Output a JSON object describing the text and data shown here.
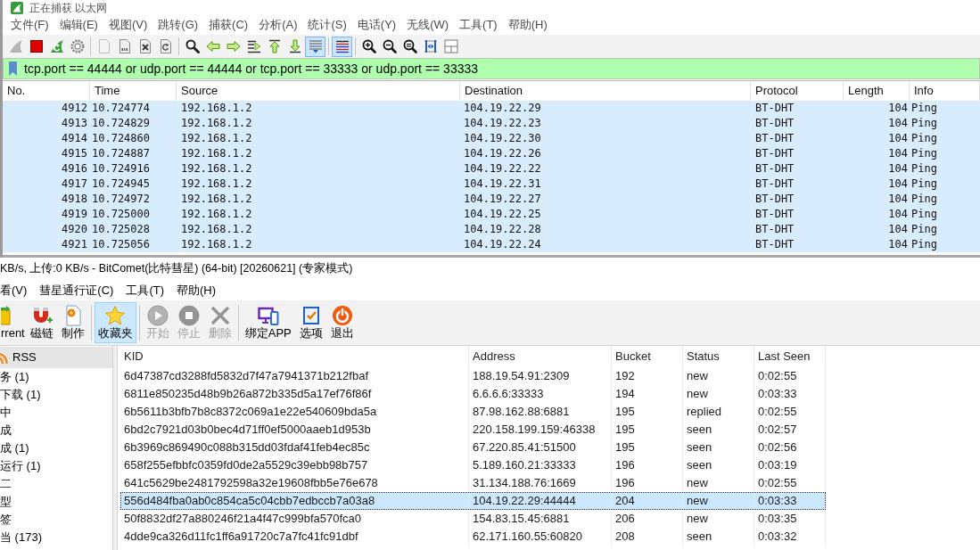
{
  "capture_window": {
    "title": "正在捕获 以太网",
    "menu": [
      "文件(F)",
      "编辑(E)",
      "视图(V)",
      "跳转(G)",
      "捕获(C)",
      "分析(A)",
      "统计(S)",
      "电话(Y)",
      "无线(W)",
      "工具(T)",
      "帮助(H)"
    ],
    "toolbar": [
      [
        {
          "pressed": false,
          "disabled": true
        },
        {
          "pressed": false,
          "disabled": false
        },
        {
          "pressed": false,
          "disabled": false
        },
        {
          "pressed": false,
          "disabled": false
        }
      ],
      [
        {
          "pressed": false,
          "disabled": true
        },
        {
          "pressed": false,
          "disabled": false
        },
        {
          "pressed": false,
          "disabled": false
        },
        {
          "pressed": false,
          "disabled": false
        }
      ],
      [
        {
          "pressed": false,
          "disabled": false
        },
        {
          "pressed": false,
          "disabled": false
        },
        {
          "pressed": false,
          "disabled": false
        },
        {
          "pressed": false,
          "disabled": false
        },
        {
          "pressed": false,
          "disabled": false
        },
        {
          "pressed": false,
          "disabled": false
        },
        {
          "pressed": true,
          "disabled": false
        }
      ],
      [
        {
          "pressed": true,
          "disabled": false
        }
      ],
      [
        {
          "pressed": false,
          "disabled": false
        },
        {
          "pressed": false,
          "disabled": false
        },
        {
          "pressed": false,
          "disabled": false
        },
        {
          "pressed": false,
          "disabled": false
        },
        {
          "pressed": false,
          "disabled": false
        }
      ]
    ],
    "filter": {
      "value": "tcp.port == 44444 or udp.port == 44444 or tcp.port == 33333 or udp.port == 33333"
    },
    "packet_list": {
      "columns": [
        "No.",
        "Time",
        "Source",
        "Destination",
        "Protocol",
        "Length",
        "Info"
      ],
      "rows": [
        [
          "4912",
          "10.724774",
          "192.168.1.2",
          "104.19.22.29",
          "BT-DHT",
          "104",
          "Ping"
        ],
        [
          "4913",
          "10.724829",
          "192.168.1.2",
          "104.19.22.23",
          "BT-DHT",
          "104",
          "Ping"
        ],
        [
          "4914",
          "10.724860",
          "192.168.1.2",
          "104.19.22.30",
          "BT-DHT",
          "104",
          "Ping"
        ],
        [
          "4915",
          "10.724887",
          "192.168.1.2",
          "104.19.22.26",
          "BT-DHT",
          "104",
          "Ping"
        ],
        [
          "4916",
          "10.724916",
          "192.168.1.2",
          "104.19.22.22",
          "BT-DHT",
          "104",
          "Ping"
        ],
        [
          "4917",
          "10.724945",
          "192.168.1.2",
          "104.19.22.31",
          "BT-DHT",
          "104",
          "Ping"
        ],
        [
          "4918",
          "10.724972",
          "192.168.1.2",
          "104.19.22.27",
          "BT-DHT",
          "104",
          "Ping"
        ],
        [
          "4919",
          "10.725000",
          "192.168.1.2",
          "104.19.22.25",
          "BT-DHT",
          "104",
          "Ping"
        ],
        [
          "4920",
          "10.725028",
          "192.168.1.2",
          "104.19.22.28",
          "BT-DHT",
          "104",
          "Ping"
        ],
        [
          "4921",
          "10.725056",
          "192.168.1.2",
          "104.19.22.24",
          "BT-DHT",
          "104",
          "Ping"
        ]
      ]
    }
  },
  "bitcomet_window": {
    "title": "KB/s, 上传:0 KB/s - BitComet(比特彗星) (64-bit) [20260621] (专家模式)",
    "menu": [
      "看(V)",
      "彗星通行证(C)",
      "工具(T)",
      "帮助(H)"
    ],
    "toolbar": [
      [
        {
          "label": "rrent",
          "selected": false,
          "disabled": false
        },
        {
          "label": "磁链",
          "selected": false,
          "disabled": false
        },
        {
          "label": "制作",
          "selected": false,
          "disabled": false
        }
      ],
      [
        {
          "label": "收藏夹",
          "selected": true,
          "disabled": false
        }
      ],
      [
        {
          "label": "开始",
          "selected": false,
          "disabled": true
        },
        {
          "label": "停止",
          "selected": false,
          "disabled": true
        },
        {
          "label": "删除",
          "selected": false,
          "disabled": true
        }
      ],
      [
        {
          "label": "绑定APP",
          "selected": false,
          "disabled": false
        },
        {
          "label": "选项",
          "selected": false,
          "disabled": false
        },
        {
          "label": "退出",
          "selected": false,
          "disabled": false
        }
      ]
    ],
    "sidebar": [
      {
        "kind": "feed",
        "label": "RSS",
        "selected": true
      },
      {
        "kind": "category",
        "label": "务 (1)",
        "selected": false
      },
      {
        "kind": "category",
        "label": "下载 (1)",
        "selected": false
      },
      {
        "kind": "category",
        "label": "中",
        "selected": false
      },
      {
        "kind": "category",
        "label": "成",
        "selected": false
      },
      {
        "kind": "category",
        "label": "成 (1)",
        "selected": false
      },
      {
        "kind": "category",
        "label": "运行 (1)",
        "selected": false
      },
      {
        "kind": "category",
        "label": "二",
        "selected": false
      },
      {
        "kind": "category",
        "label": "型",
        "selected": false
      },
      {
        "kind": "category",
        "label": "签",
        "selected": false
      },
      {
        "kind": "category",
        "label": "当 (173)",
        "selected": false
      }
    ],
    "dht_table": {
      "columns": [
        "KID",
        "Address",
        "Bucket",
        "Status",
        "Last Seen"
      ],
      "rows": [
        {
          "cells": [
            "6d47387cd3288fd5832d7f47a7941371b212fbaf",
            "188.19.54.91:2309",
            "192",
            "new",
            "0:02:55"
          ],
          "selected": false
        },
        {
          "cells": [
            "6811e850235d48b9b26a872b335d5a17ef76f86f",
            "6.6.6.6:33333",
            "194",
            "new",
            "0:03:33"
          ],
          "selected": false
        },
        {
          "cells": [
            "6b5611b3bfb7b8c8372c069a1e22e540609bda5a",
            "87.98.162.88:6881",
            "195",
            "replied",
            "0:02:55"
          ],
          "selected": false
        },
        {
          "cells": [
            "6bd2c7921d03b0bec4d71ff0ef5000aaeb1d953b",
            "220.158.199.159:46338",
            "195",
            "seen",
            "0:02:57"
          ],
          "selected": false
        },
        {
          "cells": [
            "6b3969c869490c088b315dd03fdaf41feb4ec85c",
            "67.220.85.41:51500",
            "195",
            "seen",
            "0:02:56"
          ],
          "selected": false
        },
        {
          "cells": [
            "658f255efbbfc0359fd0de2a5529c39ebb98b757",
            "5.189.160.21:33333",
            "196",
            "seen",
            "0:03:19"
          ],
          "selected": false
        },
        {
          "cells": [
            "641c5629be2481792598a32e19608fbb5e76e678",
            "31.134.188.76:1669",
            "196",
            "new",
            "0:02:55"
          ],
          "selected": false
        },
        {
          "cells": [
            "556d484fba0ab0c854ca5c04cbb7edbccb7a03a8",
            "104.19.22.29:44444",
            "204",
            "new",
            "0:03:33"
          ],
          "selected": true
        },
        {
          "cells": [
            "50f8832df27a880246f21a4f47c999bfa570fca0",
            "154.83.15.45:6881",
            "206",
            "new",
            "0:03:35"
          ],
          "selected": false
        },
        {
          "cells": [
            "4dde9ca326d11fc1ff6a91720c7a7fc41fc91dbf",
            "62.171.160.55:60820",
            "208",
            "seen",
            "0:03:32"
          ],
          "selected": false
        }
      ]
    }
  }
}
